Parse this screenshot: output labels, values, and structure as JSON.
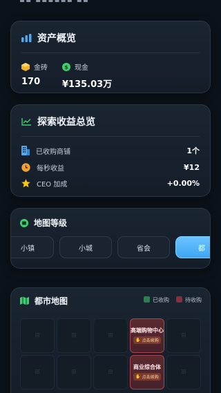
{
  "asset_overview": {
    "title": "资产概览",
    "gold_label": "金砖",
    "gold_value": "170",
    "cash_label": "现金",
    "cash_value": "¥135.03万"
  },
  "income_overview": {
    "title": "探索收益总览",
    "rows": [
      {
        "label": "已收购商铺",
        "value": "1个",
        "icon": "building-icon"
      },
      {
        "label": "每秒收益",
        "value": "¥12",
        "icon": "clock-icon"
      },
      {
        "label": "CEO 加成",
        "value": "+0.00%",
        "icon": "star-icon"
      }
    ]
  },
  "map_level": {
    "title": "地图等级",
    "levels": [
      "小镇",
      "小城",
      "省会",
      "都"
    ],
    "active_index": 3
  },
  "city_map": {
    "title": "都市地图",
    "legend_owned": "已收购",
    "legend_pending": "待收购",
    "tile_glyph": "⊞",
    "owned_tiles": [
      {
        "name": "高端购物中心",
        "button": "点击续购"
      },
      {
        "name": "商业综合体",
        "button": "点击续购"
      }
    ]
  },
  "colors": {
    "accent_blue": "#4fa8f0",
    "owned_red": "#a8434f",
    "legend_green": "#2e7d4f",
    "legend_red": "#8a2e3a"
  }
}
